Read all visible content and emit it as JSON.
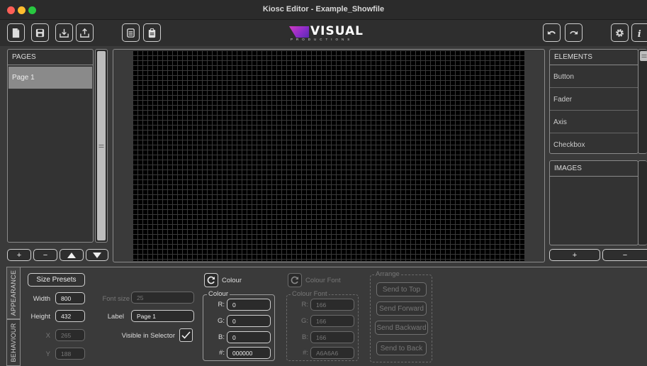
{
  "window": {
    "title": "Kiosc Editor - Example_Showfile"
  },
  "toolbar": {
    "logo_text": "VISUAL",
    "logo_sub": "PRODUCTIONS",
    "buttons": [
      "new-file-icon",
      "save-icon",
      "import-icon",
      "export-icon",
      "copy-icon",
      "paste-icon",
      "undo-icon",
      "redo-icon",
      "gear-icon",
      "info-icon"
    ]
  },
  "pages": {
    "header": "PAGES",
    "items": [
      "Page 1"
    ],
    "add_label": "+",
    "remove_label": "−"
  },
  "elements": {
    "header": "ELEMENTS",
    "items": [
      "Button",
      "Fader",
      "Axis",
      "Checkbox"
    ]
  },
  "images": {
    "header": "IMAGES",
    "add_label": "+",
    "remove_label": "−"
  },
  "tabs": {
    "appearance": "APPEARANCE",
    "behaviour": "BEHAVIOUR"
  },
  "appearance": {
    "size_presets": "Size Presets",
    "width_label": "Width",
    "width_value": "800",
    "height_label": "Height",
    "height_value": "432",
    "x_label": "X",
    "x_value": "265",
    "y_label": "Y",
    "y_value": "188",
    "font_size_label": "Font size",
    "font_size_value": "25",
    "label_label": "Label",
    "label_value": "Page 1",
    "visible_label": "Visible in Selector",
    "visible_checked": true,
    "colour_toggle_label": "Colour",
    "colour_font_toggle_label": "Colour Font",
    "colour": {
      "title": "Colour",
      "r_label": "R:",
      "r": "0",
      "g_label": "G:",
      "g": "0",
      "b_label": "B:",
      "b": "0",
      "hex_label": "#:",
      "hex": "000000"
    },
    "colour_font": {
      "title": "Colour Font",
      "r_label": "R:",
      "r": "166",
      "g_label": "G:",
      "g": "166",
      "b_label": "B:",
      "b": "166",
      "hex_label": "#:",
      "hex": "A6A6A6"
    },
    "arrange": {
      "title": "Arrange",
      "send_to_top": "Send to Top",
      "send_forward": "Send Forward",
      "send_backward": "Send Backward",
      "send_to_back": "Send to Back"
    }
  },
  "colors": {
    "canvas": "#000000",
    "accent_logo": "#b23ad0",
    "panel_bg": "#3a3a3a"
  }
}
